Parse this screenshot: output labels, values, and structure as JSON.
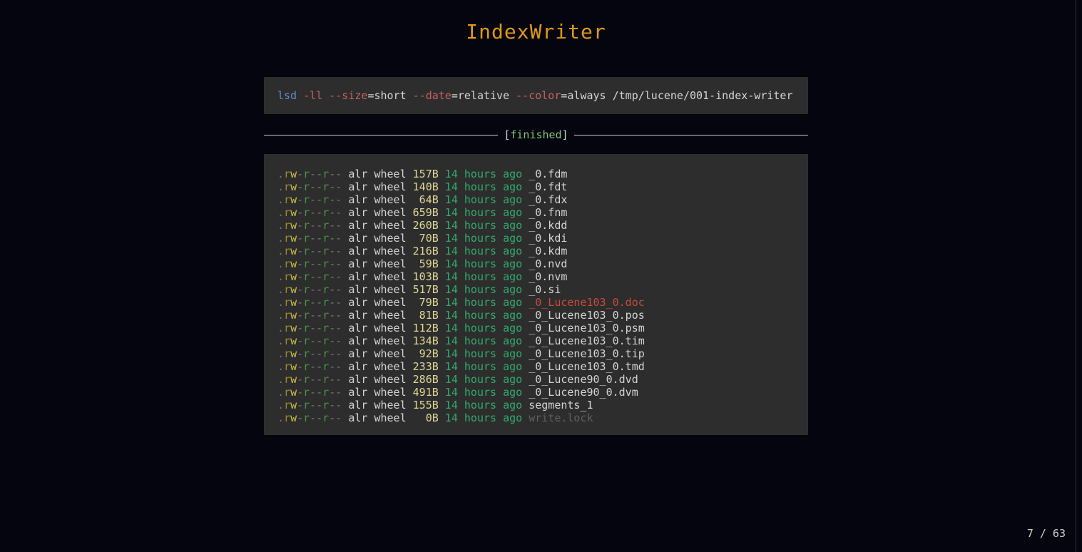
{
  "page": {
    "title": "IndexWriter",
    "footer": "7 / 63"
  },
  "command": {
    "segments": [
      {
        "text": "lsd",
        "role": "cmd"
      },
      {
        "text": " ",
        "role": "plain"
      },
      {
        "text": "-ll",
        "role": "flag"
      },
      {
        "text": " ",
        "role": "plain"
      },
      {
        "text": "--size",
        "role": "flag"
      },
      {
        "text": "=short",
        "role": "plain"
      },
      {
        "text": " ",
        "role": "plain"
      },
      {
        "text": "--date",
        "role": "flag"
      },
      {
        "text": "=relative",
        "role": "plain"
      },
      {
        "text": " ",
        "role": "plain"
      },
      {
        "text": "--color",
        "role": "flag"
      },
      {
        "text": "=always",
        "role": "plain"
      },
      {
        "text": " ",
        "role": "plain"
      },
      {
        "text": "/tmp/lucene/001-index-writer",
        "role": "plain"
      }
    ]
  },
  "status": {
    "open_bracket": "[",
    "label": "finished",
    "close_bracket": "]"
  },
  "listing": {
    "permission": ".rw-r--r--",
    "user": "alr",
    "group": "wheel",
    "date": "14 hours ago",
    "files": [
      {
        "size": "157B",
        "name": "_0.fdm",
        "style": "normal"
      },
      {
        "size": "140B",
        "name": "_0.fdt",
        "style": "normal"
      },
      {
        "size": "64B",
        "name": "_0.fdx",
        "style": "normal"
      },
      {
        "size": "659B",
        "name": "_0.fnm",
        "style": "normal"
      },
      {
        "size": "260B",
        "name": "_0.kdd",
        "style": "normal"
      },
      {
        "size": "70B",
        "name": "_0.kdi",
        "style": "normal"
      },
      {
        "size": "216B",
        "name": "_0.kdm",
        "style": "normal"
      },
      {
        "size": "59B",
        "name": "_0.nvd",
        "style": "normal"
      },
      {
        "size": "103B",
        "name": "_0.nvm",
        "style": "normal"
      },
      {
        "size": "517B",
        "name": "_0.si",
        "style": "normal"
      },
      {
        "size": "79B",
        "name": "_0_Lucene103_0.doc",
        "style": "highlight"
      },
      {
        "size": "81B",
        "name": "_0_Lucene103_0.pos",
        "style": "normal"
      },
      {
        "size": "112B",
        "name": "_0_Lucene103_0.psm",
        "style": "normal"
      },
      {
        "size": "134B",
        "name": "_0_Lucene103_0.tim",
        "style": "normal"
      },
      {
        "size": "92B",
        "name": "_0_Lucene103_0.tip",
        "style": "normal"
      },
      {
        "size": "233B",
        "name": "_0_Lucene103_0.tmd",
        "style": "normal"
      },
      {
        "size": "286B",
        "name": "_0_Lucene90_0.dvd",
        "style": "normal"
      },
      {
        "size": "491B",
        "name": "_0_Lucene90_0.dvm",
        "style": "normal"
      },
      {
        "size": "155B",
        "name": "segments_1",
        "style": "normal"
      },
      {
        "size": "0B",
        "name": "write.lock",
        "style": "dim"
      }
    ]
  },
  "colors": {
    "page_bg": "#05050f",
    "box_bg": "#2d2d2d",
    "text": "#d4d4d4",
    "accent_title": "#df9718",
    "command": "#5e8cc8",
    "flag": "#c66060",
    "separator_line": "#c9c9c9",
    "status_ok": "#84c576",
    "perm_neutral": "#767676",
    "perm_read_user": "#97893a",
    "perm_write_user": "#d0bf45",
    "perm_read_group": "#4a9245",
    "size": "#e0d795",
    "date": "#30ab6e",
    "file_highlight": "#c94a38",
    "file_dim": "#5f5f5f",
    "footer": "#cfcfcf",
    "edge_line": "#34343e"
  }
}
